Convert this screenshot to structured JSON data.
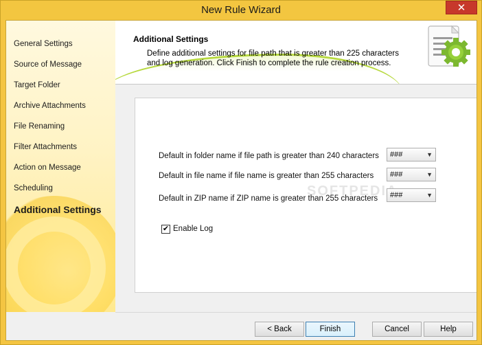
{
  "window": {
    "title": "New Rule Wizard",
    "close_glyph": "✕"
  },
  "sidebar": {
    "items": [
      {
        "label": "General Settings"
      },
      {
        "label": "Source of Message"
      },
      {
        "label": "Target Folder"
      },
      {
        "label": "Archive Attachments"
      },
      {
        "label": "File Renaming"
      },
      {
        "label": "Filter Attachments"
      },
      {
        "label": "Action on Message"
      },
      {
        "label": "Scheduling"
      },
      {
        "label": "Additional Settings",
        "active": true
      }
    ]
  },
  "header": {
    "title": "Additional Settings",
    "description": "Define additional settings for file path that is greater than 225 characters and log generation. Click Finish to complete the rule creation process.",
    "icon": "document-gear-icon"
  },
  "settings": [
    {
      "label": "Default in folder name if file path is greater than 240 characters",
      "value": "###"
    },
    {
      "label": "Default in file name if file name is greater than 255 characters",
      "value": "###"
    },
    {
      "label": "Default in ZIP name if ZIP name is greater than 255 characters",
      "value": "###"
    }
  ],
  "enable_log": {
    "label": "Enable Log",
    "checked": true,
    "check_glyph": "✔"
  },
  "buttons": {
    "back": "< Back",
    "finish": "Finish",
    "cancel": "Cancel",
    "help": "Help"
  },
  "watermark": "SOFTPEDIA",
  "colors": {
    "frame": "#f3c640",
    "close": "#c7382b",
    "accent_green": "#8bc34a"
  }
}
